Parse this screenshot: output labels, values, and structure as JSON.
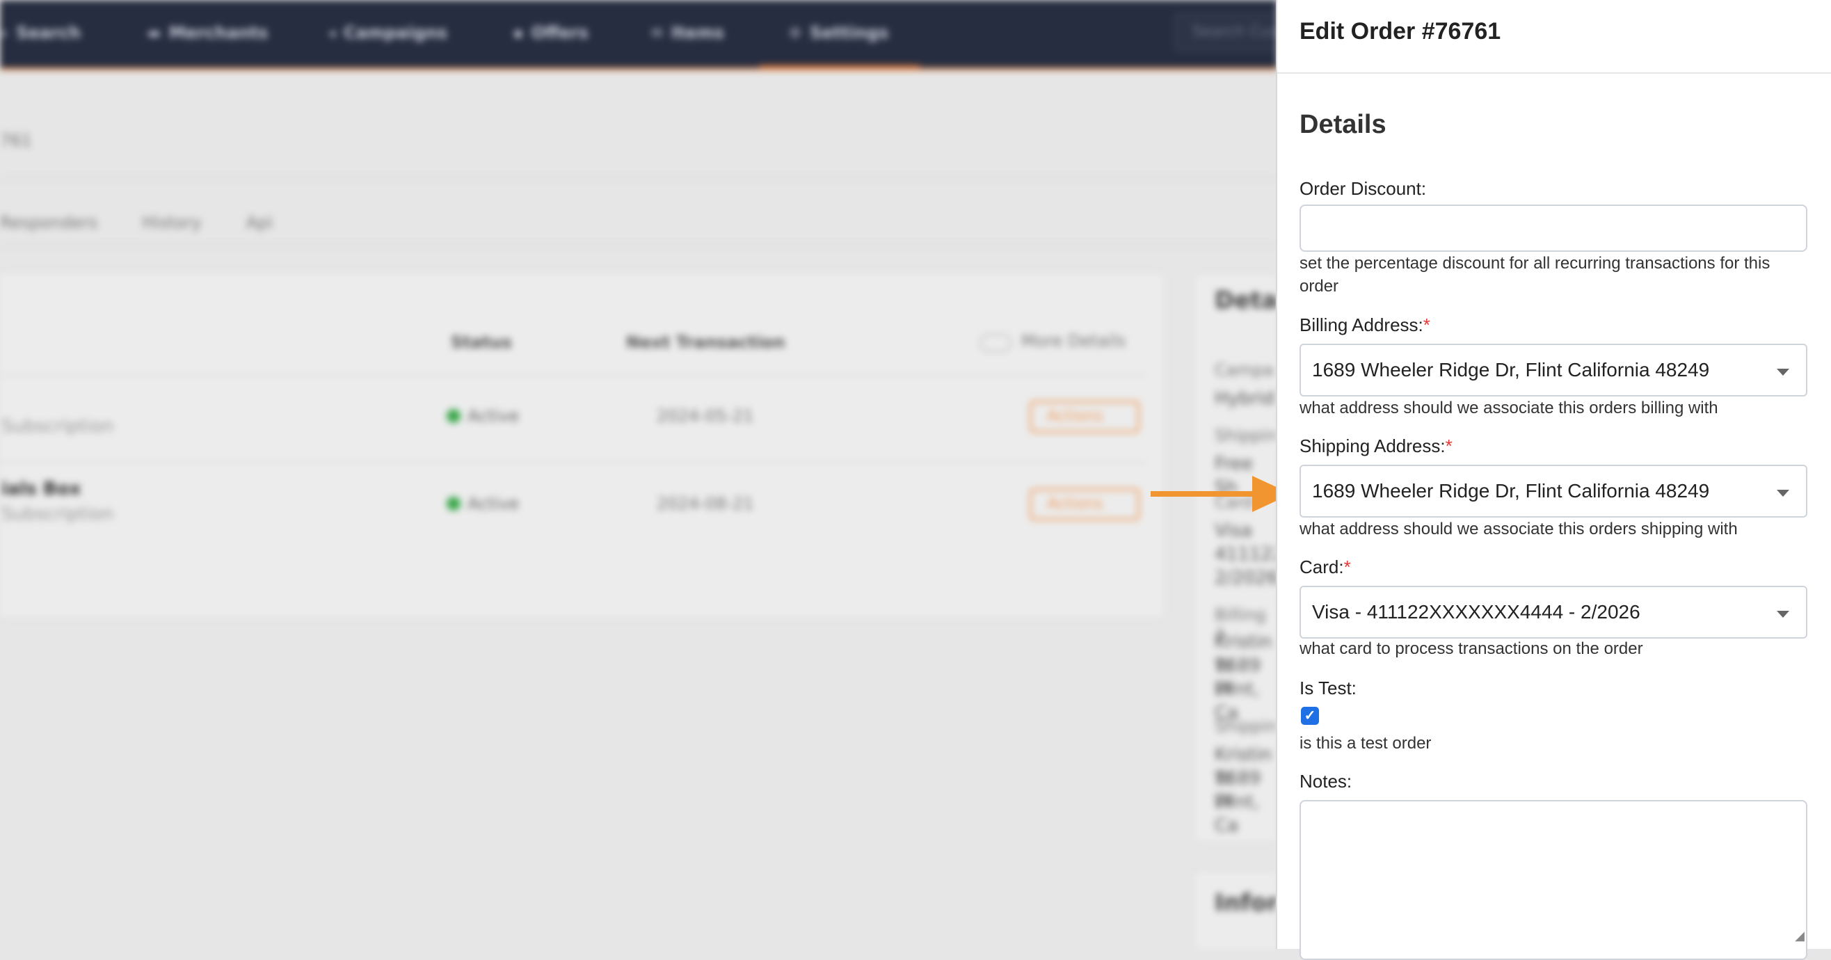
{
  "background": {
    "nav": [
      {
        "icon": "search-icon",
        "glyph": "⌕",
        "label": "Search"
      },
      {
        "icon": "merchants-icon",
        "glyph": "▬",
        "label": "Merchants"
      },
      {
        "icon": "campaigns-icon",
        "glyph": "◂",
        "label": "Campaigns"
      },
      {
        "icon": "offers-icon",
        "glyph": "▪",
        "label": "Offers"
      },
      {
        "icon": "items-icon",
        "glyph": "✉",
        "label": "Items"
      },
      {
        "icon": "settings-icon",
        "glyph": "⚙",
        "label": "Settings"
      }
    ],
    "search_placeholder": "Search Cus",
    "breadcrumb": "761",
    "tabs": [
      "Responders",
      "History",
      "Api"
    ],
    "columns": {
      "status": "Status",
      "next_transaction": "Next Transaction"
    },
    "more_details": "More Details",
    "rows": [
      {
        "name": "",
        "sub": "Subscription",
        "status": "Active",
        "date": "2024-05-21",
        "action": "Actions"
      },
      {
        "name": "ials Box",
        "sub": "Subscription",
        "status": "Active",
        "date": "2024-08-21",
        "action": "Actions"
      }
    ],
    "side": {
      "title": "Detai",
      "campaign_label": "Campa",
      "campaign_value": "Hybrid",
      "shipping_label": "Shipping",
      "shipping_value": "Free Sh",
      "card_label": "Card",
      "card_lines": [
        "Visa",
        "411122X",
        "2/2026"
      ],
      "billing_label": "Billing A",
      "billing_lines": [
        "Kristin W",
        "1689 W",
        "Flint, Ca"
      ],
      "shipping_addr_label": "Shipping",
      "shipping_lines": [
        "Kristin W",
        "1689 W",
        "Flint, Ca"
      ],
      "info_title": "Inform"
    }
  },
  "panel": {
    "title": "Edit Order #76761",
    "section": "Details",
    "order_discount": {
      "label": "Order Discount:",
      "value": "",
      "help": "set the percentage discount for all recurring transactions for this order"
    },
    "billing_address": {
      "label": "Billing Address:",
      "required": "*",
      "value": "1689 Wheeler Ridge Dr, Flint California 48249",
      "help": "what address should we associate this orders billing with"
    },
    "shipping_address": {
      "label": "Shipping Address:",
      "required": "*",
      "value": "1689 Wheeler Ridge Dr, Flint California 48249",
      "help": "what address should we associate this orders shipping with"
    },
    "card": {
      "label": "Card:",
      "required": "*",
      "value": "Visa - 411122XXXXXXX4444 - 2/2026",
      "help": "what card to process transactions on the order"
    },
    "is_test": {
      "label": "Is Test:",
      "checked": true,
      "help": "is this a test order"
    },
    "notes": {
      "label": "Notes:",
      "value": ""
    }
  },
  "colors": {
    "nav_bg": "#262d40",
    "accent_orange": "#f0952f",
    "checkbox_blue": "#1f6fe5",
    "required_red": "#e53935",
    "status_green": "#3aa84a"
  }
}
